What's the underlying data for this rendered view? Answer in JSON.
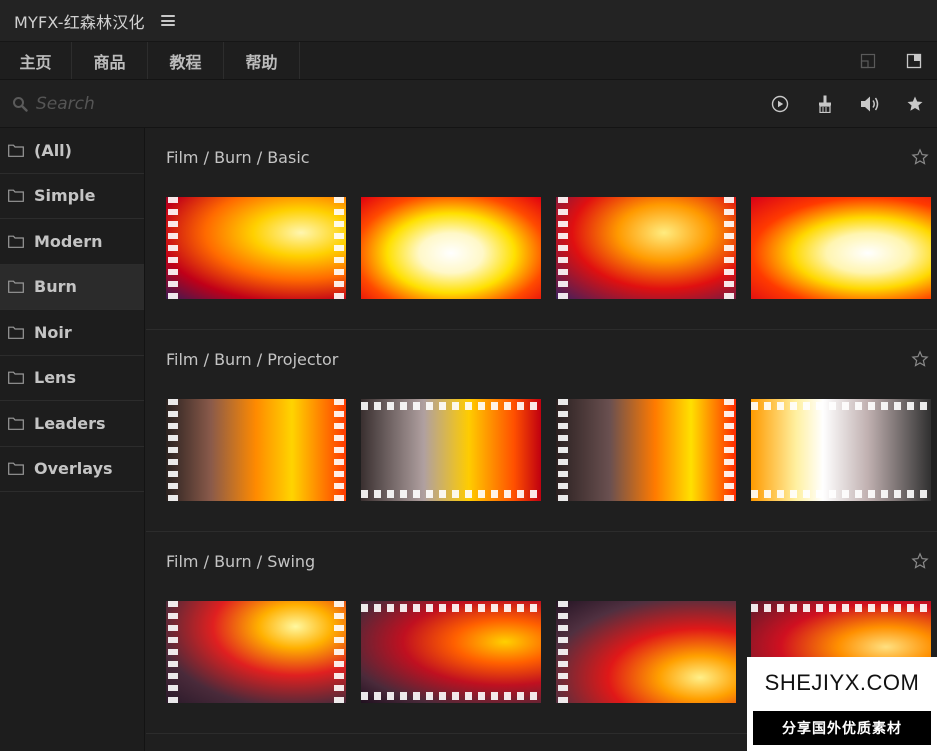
{
  "app": {
    "title": "MYFX-红森林汉化"
  },
  "nav": {
    "tabs": [
      "主页",
      "商品",
      "教程",
      "帮助"
    ]
  },
  "search": {
    "placeholder": "Search",
    "value": ""
  },
  "sidebar": {
    "items": [
      {
        "label": "(All)"
      },
      {
        "label": "Simple"
      },
      {
        "label": "Modern"
      },
      {
        "label": "Burn",
        "active": true
      },
      {
        "label": "Noir"
      },
      {
        "label": "Lens"
      },
      {
        "label": "Leaders"
      },
      {
        "label": "Overlays"
      }
    ]
  },
  "sections": [
    {
      "title": "Film / Burn / Basic",
      "thumbnails": 4
    },
    {
      "title": "Film / Burn / Projector",
      "thumbnails": 4
    },
    {
      "title": "Film / Burn / Swing",
      "thumbnails": 4
    }
  ],
  "watermark": {
    "site": "SHEJIYX.COM",
    "tagline": "分享国外优质素材"
  },
  "colors": {
    "background": "#1f1f1f",
    "panel": "#232323",
    "text": "#c8c8c8",
    "active_item": "#2b2b2b"
  }
}
